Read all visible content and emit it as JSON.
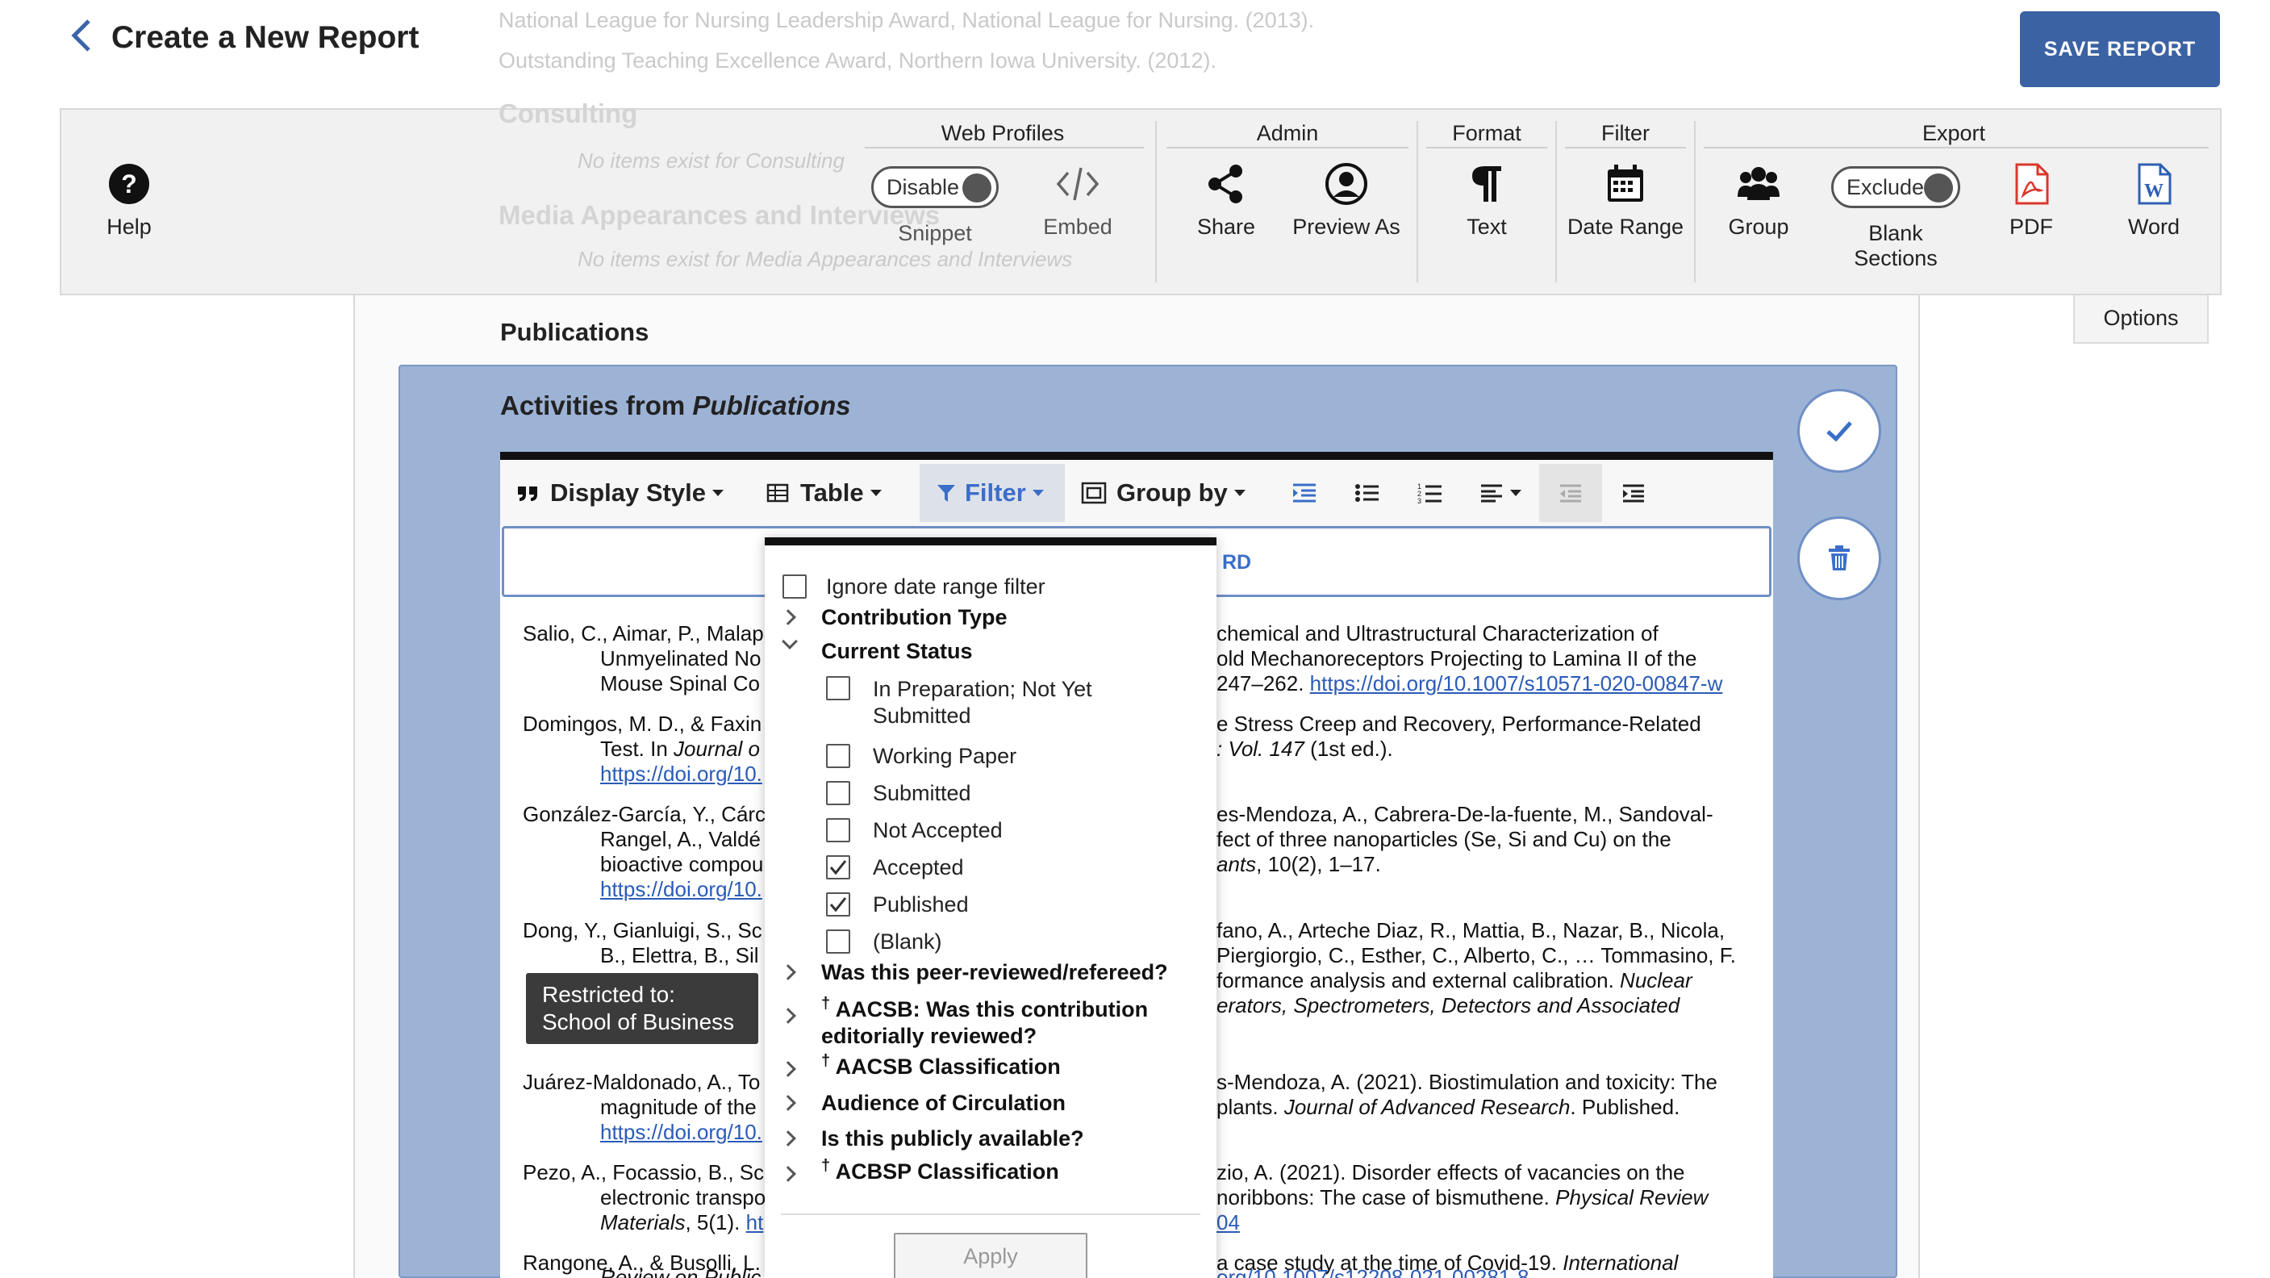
{
  "header": {
    "title": "Create a New Report",
    "save_label": "SAVE REPORT",
    "background_lines": [
      "National League for Nursing Leadership Award, National League for Nursing. (2013).",
      "Outstanding Teaching Excellence Award, Northern Iowa University. (2012).",
      "Consulting",
      "No items exist for Consulting",
      "Media Appearances and Interviews",
      "No items exist for Media Appearances and Interviews"
    ]
  },
  "toolbar": {
    "help_label": "Help",
    "groups": {
      "web_profiles": "Web Profiles",
      "admin": "Admin",
      "format": "Format",
      "filter": "Filter",
      "export": "Export"
    },
    "snippet_toggle": "Disable",
    "snippet_label": "Snippet",
    "embed_label": "Embed",
    "share_label": "Share",
    "preview_label": "Preview As",
    "text_label": "Text",
    "date_range_label": "Date Range",
    "group_label": "Group",
    "blank_toggle": "Exclude",
    "blank_label_1": "Blank",
    "blank_label_2": "Sections",
    "pdf_label": "PDF",
    "word_label": "Word",
    "options_label": "Options"
  },
  "section": {
    "title": "Publications",
    "card_title_prefix": "Activities from ",
    "card_title_em": "Publications"
  },
  "editor": {
    "display_style": "Display Style",
    "table": "Table",
    "filter": "Filter",
    "group_by": "Group by",
    "input_partial": "RD"
  },
  "citations": {
    "c1_l1a": "Salio, C., Aimar, P., Malap",
    "c1_l1b": "chemical and Ultrastructural Characterization of",
    "c1_l2a": "Unmyelinated No",
    "c1_l2b": "old Mechanoreceptors Projecting to Lamina II of the",
    "c1_l3a": "Mouse Spinal Co",
    "c1_l3b": "247–262. ",
    "c1_link": "https://doi.org/10.1007/s10571-020-00847-w",
    "c2_l1a": "Domingos, M. D., & Faxin",
    "c2_l1b": "e Stress Creep and Recovery, Performance-Related",
    "c2_l2a": "Test. In ",
    "c2_l2a_em": "Journal o",
    "c2_l2b_em": ": Vol. 147",
    "c2_l2b": " (1st ed.).",
    "c2_link": "https://doi.org/10.",
    "c3_l1a": "González-García, Y., Cárc",
    "c3_l1b": "es-Mendoza, A., Cabrera-De-la-fuente, M., Sandoval-",
    "c3_l2a": "Rangel, A., Valdé",
    "c3_l2b": "fect of three nanoparticles (Se, Si and Cu) on the",
    "c3_l3a": "bioactive compou",
    "c3_l3b_em": "ants",
    "c3_l3b": ", 10(2), 1–17.",
    "c3_link": "https://doi.org/10.",
    "c4_l1a": "Dong, Y., Gianluigi, S., Sc",
    "c4_l1b": "fano, A., Arteche Diaz, R., Mattia, B., Nazar, B., Nicola,",
    "c4_l2a": "B., Elettra, B., Sil",
    "c4_l2b": "Piergiorgio, C., Esther, C., Alberto, C., … Tommasino, F.",
    "c4_l3b": "formance analysis and external calibration. ",
    "c4_l3b_em": "Nuclear",
    "c4_l4b_em": "erators, Spectrometers, Detectors and Associated",
    "c5_l1a": "Juárez-Maldonado, A., To",
    "c5_l1b": "s-Mendoza, A. (2021). Biostimulation and toxicity: The",
    "c5_l2a": "magnitude of the",
    "c5_l2b": " plants. ",
    "c5_l2b_em": "Journal of Advanced Research",
    "c5_l2b_end": ". Published.",
    "c5_link": "https://doi.org/10.",
    "c6_l1a": "Pezo, A., Focassio, B., Sc",
    "c6_l1b": "zio, A. (2021). Disorder effects of vacancies on the",
    "c6_l2a": "electronic transpo",
    "c6_l2b": "noribbons: The case of bismuthene. ",
    "c6_l2b_em": "Physical Review",
    "c6_l3a_em": "Materials",
    "c6_l3a": ", 5(1). ",
    "c6_l3a_link": "ht",
    "c6_l3b_link": "04",
    "c7_l1a": "Rangone, A., & Busolli, L.",
    "c7_l1b": "a case study at the time of Covid-19. ",
    "c7_l1b_em": "International",
    "c7_l2a_em": "Review on Public",
    "c7_l2b_link": "org/10.1007/s12208-021-00281-8"
  },
  "tooltip": {
    "line1": "Restricted to:",
    "line2": "School of Business"
  },
  "filter_dropdown": {
    "ignore_date": "Ignore date range filter",
    "contribution_type": "Contribution Type",
    "current_status": "Current Status",
    "status_options": [
      {
        "label": "In Preparation; Not Yet",
        "label2": "Submitted",
        "checked": false
      },
      {
        "label": "Working Paper",
        "checked": false
      },
      {
        "label": "Submitted",
        "checked": false
      },
      {
        "label": "Not Accepted",
        "checked": false
      },
      {
        "label": "Accepted",
        "checked": true
      },
      {
        "label": "Published",
        "checked": true
      },
      {
        "label": "(Blank)",
        "checked": false
      }
    ],
    "peer_reviewed": "Was this peer-reviewed/refereed?",
    "dagger": "†",
    "aacsb_editorial_1": "AACSB: Was this contribution",
    "aacsb_editorial_2": "editorially reviewed?",
    "aacsb_class": "AACSB Classification",
    "audience": "Audience of Circulation",
    "publicly": "Is this publicly available?",
    "acbsp": "ACBSP Classification",
    "apply": "Apply"
  },
  "colors": {
    "accent": "#3b62a3",
    "link": "#2a5bb8",
    "card": "#9db3d6",
    "pdf": "#d9372c",
    "word": "#2f5fb3"
  }
}
